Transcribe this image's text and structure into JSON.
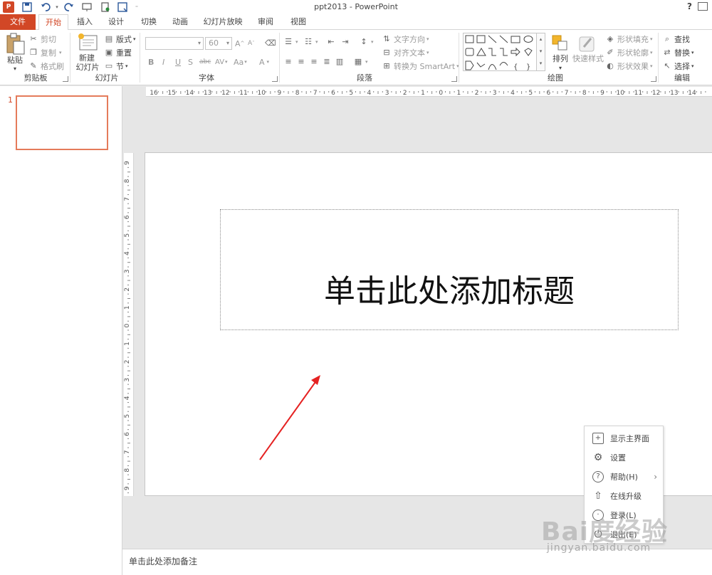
{
  "window": {
    "title": "ppt2013 - PowerPoint",
    "app_logo": "P",
    "help": "?"
  },
  "quick_access": {
    "icons": [
      "save-icon",
      "undo-icon",
      "redo-icon",
      "slideshow-icon",
      "print-preview-icon",
      "customize-icon"
    ]
  },
  "tabs": [
    {
      "label": "文件"
    },
    {
      "label": "开始"
    },
    {
      "label": "插入"
    },
    {
      "label": "设计"
    },
    {
      "label": "切换"
    },
    {
      "label": "动画"
    },
    {
      "label": "幻灯片放映"
    },
    {
      "label": "审阅"
    },
    {
      "label": "视图"
    }
  ],
  "ribbon": {
    "clipboard": {
      "label": "剪贴板",
      "paste": "粘贴",
      "cut": "剪切",
      "copy": "复制",
      "format_painter": "格式刷"
    },
    "slides": {
      "label": "幻灯片",
      "new_slide_1": "新建",
      "new_slide_2": "幻灯片",
      "layout": "版式",
      "reset": "重置",
      "section": "节"
    },
    "font": {
      "label": "字体",
      "font_name": "",
      "font_size": "60",
      "bold": "B",
      "italic": "I",
      "underline": "U",
      "shadow": "S",
      "strike": "abc",
      "spacing": "AV",
      "case": "Aa",
      "color": "A",
      "grow": "A",
      "shrink": "A"
    },
    "paragraph": {
      "label": "段落",
      "text_direction": "文字方向",
      "align_text": "对齐文本",
      "smartart": "转换为 SmartArt"
    },
    "drawing": {
      "label": "绘图",
      "arrange": "排列",
      "quick_styles": "快速样式",
      "shape_fill": "形状填充",
      "shape_outline": "形状轮廓",
      "shape_effects": "形状效果"
    },
    "editing": {
      "label": "编辑",
      "find": "查找",
      "replace": "替换",
      "select": "选择"
    }
  },
  "ruler": {
    "h_ticks": [
      "16",
      "15",
      "14",
      "13",
      "12",
      "11",
      "10",
      "9",
      "8",
      "7",
      "6",
      "5",
      "4",
      "3",
      "2",
      "1",
      "0",
      "1",
      "2",
      "3",
      "4",
      "5",
      "6",
      "7",
      "8",
      "9",
      "10",
      "11",
      "12",
      "13",
      "14"
    ],
    "v_ticks": [
      "9",
      "8",
      "7",
      "6",
      "5",
      "4",
      "3",
      "2",
      "1",
      "0",
      "1",
      "2",
      "3",
      "4",
      "5",
      "6",
      "7",
      "8",
      "9"
    ]
  },
  "thumbnails": [
    {
      "number": "1"
    }
  ],
  "slide": {
    "title_placeholder": "单击此处添加标题"
  },
  "annotation": {
    "arrow_color": "#e52222"
  },
  "notes": {
    "placeholder": "单击此处添加备注"
  },
  "context_menu": {
    "items": [
      {
        "label": "显示主界面",
        "icon": "plus-box-icon"
      },
      {
        "label": "设置",
        "icon": "gear-icon"
      },
      {
        "label": "帮助(H)",
        "icon": "help-circle-icon",
        "has_submenu": true
      },
      {
        "label": "在线升级",
        "icon": "upgrade-icon"
      },
      {
        "label": "登录(L)",
        "icon": "login-icon"
      },
      {
        "label": "退出(E)",
        "icon": "exit-icon"
      }
    ]
  },
  "watermark": {
    "logo": "Bai度经验",
    "url": "jingyan.baidu.com"
  },
  "colors": {
    "accent": "#d24726",
    "thumb_border": "#e57b5a",
    "quick_access": "#2b579a"
  }
}
